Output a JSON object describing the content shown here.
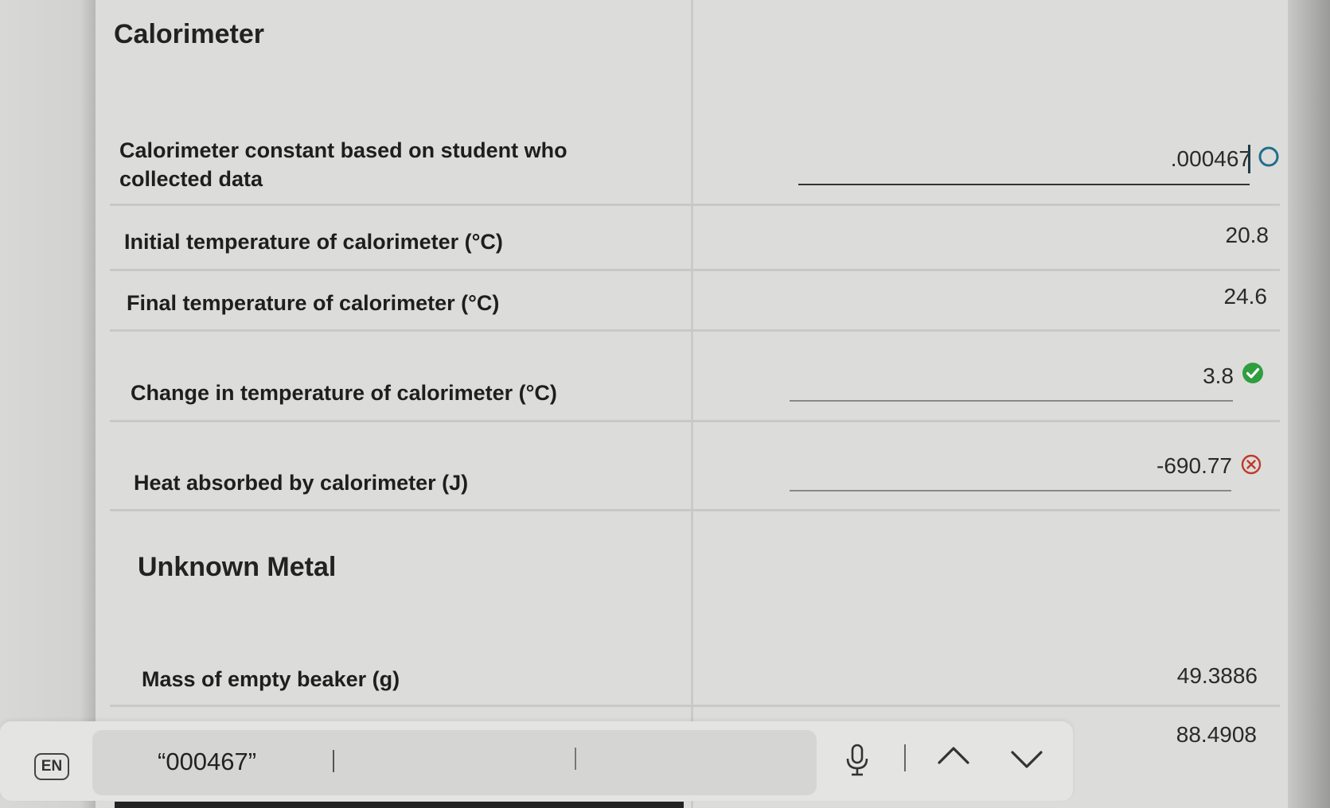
{
  "sections": {
    "calorimeter_title": "Calorimeter",
    "unknown_metal_title": "Unknown Metal"
  },
  "rows": [
    {
      "label": "Calorimeter constant based on student who collected data",
      "value": ".000467",
      "status": "editing"
    },
    {
      "label": "Initial temperature of calorimeter (°C)",
      "value": "20.8",
      "status": "none"
    },
    {
      "label": "Final temperature of calorimeter (°C)",
      "value": "24.6",
      "status": "none"
    },
    {
      "label": "Change in temperature of calorimeter (°C)",
      "value": "3.8",
      "status": "correct"
    },
    {
      "label": "Heat absorbed by calorimeter (J)",
      "value": "-690.77",
      "status": "incorrect"
    },
    {
      "label": "Mass of empty beaker (g)",
      "value": "49.3886",
      "status": "none"
    },
    {
      "label": "",
      "value": "88.4908",
      "status": "none"
    }
  ],
  "dictation": {
    "language": "EN",
    "text": "“000467”"
  },
  "colors": {
    "correct": "#2e9e3e",
    "incorrect": "#c0392b",
    "editing": "#1f6f8b"
  },
  "icons": {
    "microphone": "microphone-icon",
    "up": "chevron-up-icon",
    "down": "chevron-down-icon"
  }
}
